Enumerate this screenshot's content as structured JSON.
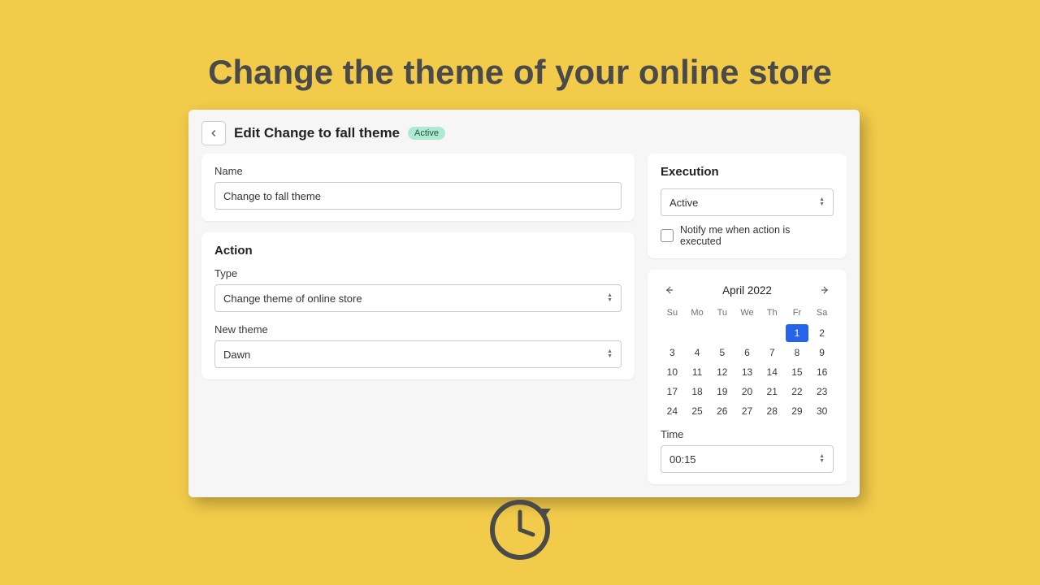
{
  "headline": "Change the theme of your online store",
  "panel": {
    "title": "Edit Change to fall theme",
    "badge": "Active"
  },
  "name": {
    "label": "Name",
    "value": "Change to fall theme"
  },
  "action": {
    "title": "Action",
    "type_label": "Type",
    "type_value": "Change theme of online store",
    "new_theme_label": "New theme",
    "new_theme_value": "Dawn"
  },
  "execution": {
    "title": "Execution",
    "status_value": "Active",
    "notify_label": "Notify me when action is executed"
  },
  "calendar": {
    "month": "April 2022",
    "dow": [
      "Su",
      "Mo",
      "Tu",
      "We",
      "Th",
      "Fr",
      "Sa"
    ],
    "leading_empty": 5,
    "days": [
      1,
      2,
      3,
      4,
      5,
      6,
      7,
      8,
      9,
      10,
      11,
      12,
      13,
      14,
      15,
      16,
      17,
      18,
      19,
      20,
      21,
      22,
      23,
      24,
      25,
      26,
      27,
      28,
      29,
      30
    ],
    "selected": 1
  },
  "time": {
    "label": "Time",
    "value": "00:15"
  }
}
